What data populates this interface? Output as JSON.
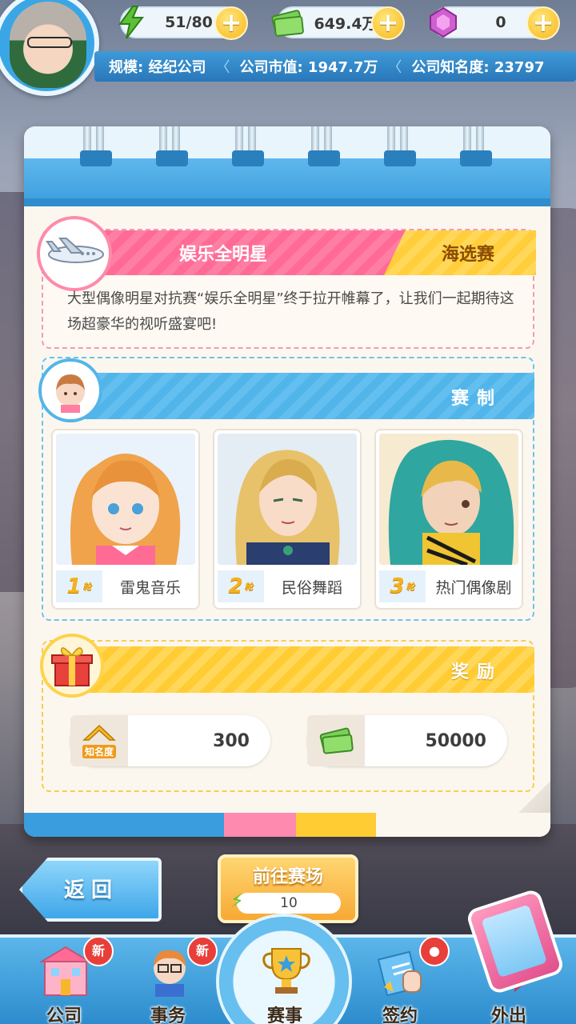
{
  "hud": {
    "energy": "51/80",
    "cash": "649.4万",
    "gems": "0",
    "plus_label": "+",
    "scale": "规模: 经纪公司",
    "market_value": "公司市值: 1947.7万",
    "fame": "公司知名度: 23797"
  },
  "event": {
    "title": "娱乐全明星",
    "stage": "海选赛",
    "description": "大型偶像明星对抗赛“娱乐全明星”终于拉开帷幕了，让我们一起期待这场超豪华的视听盛宴吧!"
  },
  "format": {
    "heading": "赛制",
    "rounds": [
      {
        "num": "1",
        "suffix": "轮",
        "name": "雷鬼音乐"
      },
      {
        "num": "2",
        "suffix": "轮",
        "name": "民俗舞蹈"
      },
      {
        "num": "3",
        "suffix": "轮",
        "name": "热门偶像剧"
      }
    ]
  },
  "rewards": {
    "heading": "奖励",
    "fame_icon_label": "知名度",
    "fame_value": "300",
    "cash_value": "50000"
  },
  "actions": {
    "back": "返回",
    "go": "前往赛场",
    "go_cost": "10"
  },
  "nav": {
    "company": "公司",
    "affairs": "事务",
    "events": "赛事",
    "sign": "签约",
    "outing": "外出",
    "new_badge": "新"
  },
  "colors": {
    "accent_blue": "#3a9ddd",
    "accent_pink": "#ff6b95",
    "accent_yellow": "#ffcc33"
  }
}
